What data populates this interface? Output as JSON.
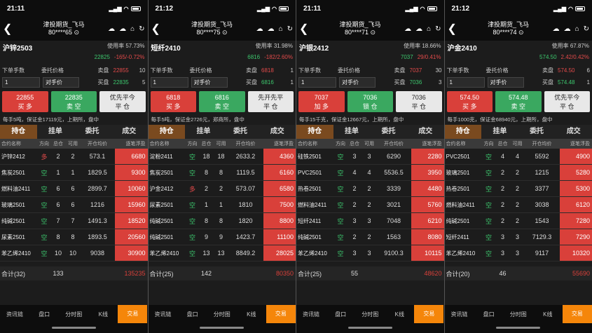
{
  "common": {
    "header_title": "津投期货_飞马",
    "labels": {
      "usage": "使用率",
      "qty": "下单手数",
      "price": "委托价格",
      "sell": "卖盘",
      "buy": "买盘",
      "counter": "对手价"
    },
    "tabs": [
      "持仓",
      "挂单",
      "委托",
      "成交"
    ],
    "cols": [
      "合约名称",
      "方向",
      "总仓",
      "可用",
      "开仓均价",
      "逐笔浮盈"
    ],
    "nav": [
      "资讯链",
      "盘口",
      "分时图",
      "K线",
      "交易"
    ],
    "colors": {
      "accent": "#f5860a",
      "up": "#e24a4a",
      "down": "#3cc76d"
    }
  },
  "panels": [
    {
      "time": "21:11",
      "account": "80****65",
      "contract": "沪锌2503",
      "usage": "57.73%",
      "price": "22825",
      "change": "-165/-0.72%",
      "sell_price": "22855",
      "sell_vol": "10",
      "buy_price": "22835",
      "buy_vol": "5",
      "qty": "1",
      "buttons": [
        {
          "top": "22855",
          "bottom": "买 多",
          "color": "red"
        },
        {
          "top": "22835",
          "bottom": "卖 空",
          "color": "green"
        },
        {
          "top": "优先平今",
          "bottom": "平 仓",
          "color": "gray"
        }
      ],
      "note": "每手5吨，保证金17119元，上期所，盘中",
      "rows": [
        {
          "name": "沪锌2412",
          "dir": "多",
          "total": "2",
          "avail": "2",
          "avg": "573.1",
          "pnl": "6680"
        },
        {
          "name": "焦炭2501",
          "dir": "空",
          "total": "1",
          "avail": "1",
          "avg": "1829.5",
          "pnl": "9300"
        },
        {
          "name": "燃料油2411",
          "dir": "空",
          "total": "6",
          "avail": "6",
          "avg": "2899.7",
          "pnl": "10060"
        },
        {
          "name": "玻璃2501",
          "dir": "空",
          "total": "6",
          "avail": "6",
          "avg": "1216",
          "pnl": "15960"
        },
        {
          "name": "纯碱2501",
          "dir": "空",
          "total": "7",
          "avail": "7",
          "avg": "1491.3",
          "pnl": "18520"
        },
        {
          "name": "尿素2501",
          "dir": "空",
          "total": "8",
          "avail": "8",
          "avg": "1893.5",
          "pnl": "20560"
        },
        {
          "name": "苯乙烯2410",
          "dir": "空",
          "total": "10",
          "avail": "10",
          "avg": "9038",
          "pnl": "30900"
        }
      ],
      "total_label": "合计(32)",
      "total_qty": "133",
      "total_pnl": "135235"
    },
    {
      "time": "21:12",
      "account": "80****75",
      "contract": "短纤2410",
      "usage": "31.98%",
      "price": "6816",
      "change": "-182/2.60%",
      "sell_price": "6818",
      "sell_vol": "1",
      "buy_price": "6816",
      "buy_vol": "1",
      "qty": "1",
      "buttons": [
        {
          "top": "6818",
          "bottom": "买 多",
          "color": "red"
        },
        {
          "top": "6816",
          "bottom": "卖 空",
          "color": "green"
        },
        {
          "top": "先开先平",
          "bottom": "平 仓",
          "color": "gray"
        }
      ],
      "note": "每手5吨，保证金2726元，郑商所，盘中",
      "rows": [
        {
          "name": "淀粉2411",
          "dir": "空",
          "total": "18",
          "avail": "18",
          "avg": "2633.2",
          "pnl": "4360"
        },
        {
          "name": "焦炭2501",
          "dir": "空",
          "total": "8",
          "avail": "8",
          "avg": "1119.5",
          "pnl": "6160"
        },
        {
          "name": "沪金2412",
          "dir": "多",
          "total": "2",
          "avail": "2",
          "avg": "573.07",
          "pnl": "6580"
        },
        {
          "name": "尿素2501",
          "dir": "空",
          "total": "1",
          "avail": "1",
          "avg": "1810",
          "pnl": "7500"
        },
        {
          "name": "纯碱2501",
          "dir": "空",
          "total": "8",
          "avail": "8",
          "avg": "1820",
          "pnl": "8800"
        },
        {
          "name": "纯碱2501",
          "dir": "空",
          "total": "9",
          "avail": "9",
          "avg": "1423.7",
          "pnl": "11100"
        },
        {
          "name": "苯乙烯2410",
          "dir": "空",
          "total": "13",
          "avail": "13",
          "avg": "8849.2",
          "pnl": "28025"
        }
      ],
      "total_label": "合计(25)",
      "total_qty": "142",
      "total_pnl": "80350"
    },
    {
      "time": "21:11",
      "account": "80****71",
      "contract": "沪银2412",
      "usage": "18.66%",
      "price": "7037",
      "change": "29/0.41%",
      "sell_price": "7037",
      "sell_vol": "30",
      "buy_price": "7036",
      "buy_vol": "3",
      "qty": "1",
      "buttons": [
        {
          "top": "7037",
          "bottom": "加 多",
          "color": "red"
        },
        {
          "top": "7036",
          "bottom": "锁 仓",
          "color": "green"
        },
        {
          "top": "7036",
          "bottom": "平 仓",
          "color": "gray"
        }
      ],
      "note": "每手15千克，保证金12667元，上期所，盘中",
      "rows": [
        {
          "name": "硅铁2501",
          "dir": "空",
          "total": "3",
          "avail": "3",
          "avg": "6290",
          "pnl": "2280"
        },
        {
          "name": "PVC2501",
          "dir": "空",
          "total": "4",
          "avail": "4",
          "avg": "5536.5",
          "pnl": "3950"
        },
        {
          "name": "热卷2501",
          "dir": "空",
          "total": "2",
          "avail": "2",
          "avg": "3339",
          "pnl": "4480"
        },
        {
          "name": "燃料油2411",
          "dir": "空",
          "total": "2",
          "avail": "2",
          "avg": "3021",
          "pnl": "5760"
        },
        {
          "name": "短纤2411",
          "dir": "空",
          "total": "3",
          "avail": "3",
          "avg": "7048",
          "pnl": "6210"
        },
        {
          "name": "纯碱2501",
          "dir": "空",
          "total": "2",
          "avail": "2",
          "avg": "1563",
          "pnl": "8080"
        },
        {
          "name": "苯乙烯2410",
          "dir": "空",
          "total": "3",
          "avail": "3",
          "avg": "9100.3",
          "pnl": "10115"
        }
      ],
      "total_label": "合计(25)",
      "total_qty": "55",
      "total_pnl": "48620"
    },
    {
      "time": "21:12",
      "account": "80****74",
      "contract": "沪金2410",
      "usage": "67.87%",
      "price": "574.50",
      "change": "2.42/0.42%",
      "sell_price": "574.50",
      "sell_vol": "6",
      "buy_price": "574.48",
      "buy_vol": "1",
      "qty": "1",
      "buttons": [
        {
          "top": "574.50",
          "bottom": "买 多",
          "color": "red"
        },
        {
          "top": "574.48",
          "bottom": "卖 空",
          "color": "green"
        },
        {
          "top": "优先平今",
          "bottom": "平 仓",
          "color": "gray"
        }
      ],
      "note": "每手1000克，保证金68940元，上期所，盘中",
      "rows": [
        {
          "name": "PVC2501",
          "dir": "空",
          "total": "4",
          "avail": "4",
          "avg": "5592",
          "pnl": "4900"
        },
        {
          "name": "玻璃2501",
          "dir": "空",
          "total": "2",
          "avail": "2",
          "avg": "1215",
          "pnl": "5280"
        },
        {
          "name": "热卷2501",
          "dir": "空",
          "total": "2",
          "avail": "2",
          "avg": "3377",
          "pnl": "5300"
        },
        {
          "name": "燃料油2411",
          "dir": "空",
          "total": "2",
          "avail": "2",
          "avg": "3038",
          "pnl": "6120"
        },
        {
          "name": "纯碱2501",
          "dir": "空",
          "total": "2",
          "avail": "2",
          "avg": "1543",
          "pnl": "7280"
        },
        {
          "name": "短纤2411",
          "dir": "空",
          "total": "3",
          "avail": "3",
          "avg": "7129.3",
          "pnl": "7290"
        },
        {
          "name": "苯乙烯2410",
          "dir": "空",
          "total": "3",
          "avail": "3",
          "avg": "9117",
          "pnl": "10320"
        }
      ],
      "total_label": "合计(20)",
      "total_qty": "46",
      "total_pnl": "55690"
    }
  ]
}
